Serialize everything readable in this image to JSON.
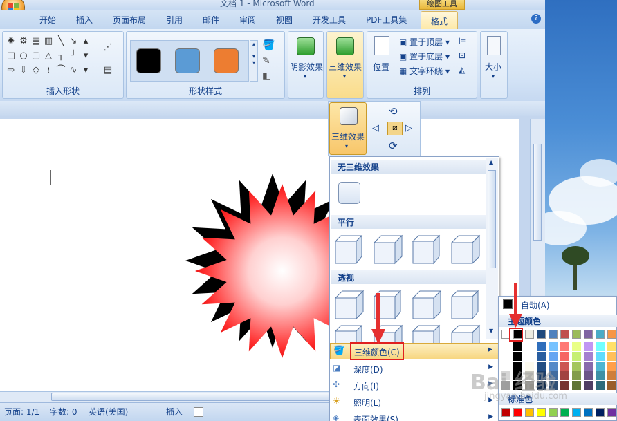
{
  "window": {
    "title": "文档 1 - Microsoft Word",
    "context_tab": "绘图工具"
  },
  "tabs": [
    {
      "label": "开始"
    },
    {
      "label": "插入"
    },
    {
      "label": "页面布局"
    },
    {
      "label": "引用"
    },
    {
      "label": "邮件"
    },
    {
      "label": "审阅"
    },
    {
      "label": "视图"
    },
    {
      "label": "开发工具"
    },
    {
      "label": "PDF工具集"
    },
    {
      "label": "格式"
    }
  ],
  "ribbon": {
    "insert_shapes": {
      "label": "插入形状"
    },
    "shape_styles": {
      "label": "形状样式",
      "colors": [
        "#000000",
        "#5b9bd5",
        "#ed7d31"
      ]
    },
    "shadow": {
      "label": "阴影效果"
    },
    "threed": {
      "label": "三维效果"
    },
    "arrange": {
      "label": "排列",
      "position": "位置",
      "bring_front": "置于顶层",
      "send_back": "置于底层",
      "text_wrap": "文字环绕"
    },
    "size": {
      "label": "大小"
    }
  },
  "popup_3d": {
    "label": "三维效果"
  },
  "gallery": {
    "sections": [
      {
        "title": "无三维效果"
      },
      {
        "title": "平行"
      },
      {
        "title": "透视"
      }
    ],
    "menu": [
      {
        "label": "三维颜色(C)"
      },
      {
        "label": "深度(D)"
      },
      {
        "label": "方向(I)"
      },
      {
        "label": "照明(L)"
      },
      {
        "label": "表面效果(S)"
      }
    ]
  },
  "color_panel": {
    "auto": "自动(A)",
    "theme_label": "主题颜色",
    "standard_label": "标准色",
    "theme_colors": [
      "#ffffff",
      "#000000",
      "#eeece1",
      "#1f497d",
      "#4f81bd",
      "#c0504d",
      "#9bbb59",
      "#8064a2",
      "#4bacc6",
      "#f79646"
    ],
    "standard_colors": [
      "#c00000",
      "#ff0000",
      "#ffc000",
      "#ffff00",
      "#92d050",
      "#00b050",
      "#00b0f0",
      "#0070c0",
      "#002060",
      "#7030a0"
    ]
  },
  "statusbar": {
    "page": "页面: 1/1",
    "words": "字数: 0",
    "language": "英语(美国)",
    "mode": "插入"
  },
  "watermark": {
    "text": "Bai 经验",
    "sub": "jingyan.baidu.com"
  }
}
